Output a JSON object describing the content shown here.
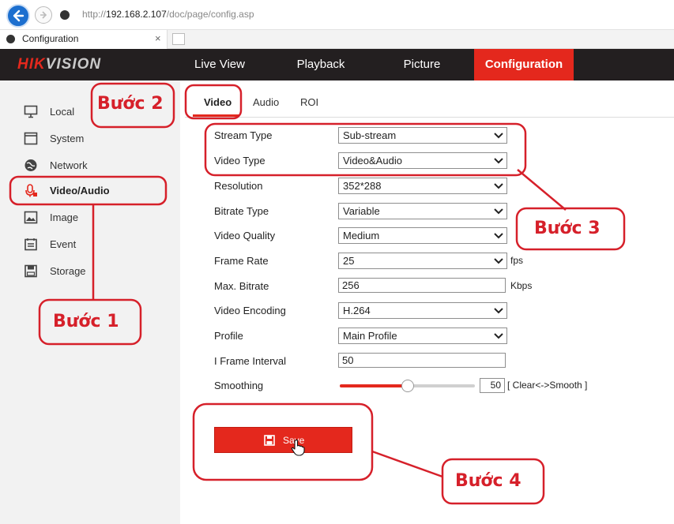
{
  "browser": {
    "url_prefix": "http://",
    "url_host": "192.168.2.107",
    "url_path": "/doc/page/config.asp",
    "tab_title": "Configuration",
    "tab_close": "×"
  },
  "header": {
    "logo_red": "HIK",
    "logo_grey": "VISION",
    "nav": [
      "Live View",
      "Playback",
      "Picture",
      "Configuration"
    ]
  },
  "sidebar": {
    "items": [
      {
        "label": "Local",
        "icon": "monitor-icon"
      },
      {
        "label": "System",
        "icon": "window-icon"
      },
      {
        "label": "Network",
        "icon": "globe-icon"
      },
      {
        "label": "Video/Audio",
        "icon": "microphone-icon"
      },
      {
        "label": "Image",
        "icon": "image-icon"
      },
      {
        "label": "Event",
        "icon": "calendar-icon"
      },
      {
        "label": "Storage",
        "icon": "disk-icon"
      }
    ],
    "active": "Video/Audio"
  },
  "tabs": [
    "Video",
    "Audio",
    "ROI"
  ],
  "form": {
    "stream_type": {
      "label": "Stream Type",
      "value": "Sub-stream"
    },
    "video_type": {
      "label": "Video Type",
      "value": "Video&Audio"
    },
    "resolution": {
      "label": "Resolution",
      "value": "352*288"
    },
    "bitrate_type": {
      "label": "Bitrate Type",
      "value": "Variable"
    },
    "video_quality": {
      "label": "Video Quality",
      "value": "Medium"
    },
    "frame_rate": {
      "label": "Frame Rate",
      "value": "25",
      "unit": "fps"
    },
    "max_bitrate": {
      "label": "Max. Bitrate",
      "value": "256",
      "unit": "Kbps"
    },
    "video_encoding": {
      "label": "Video Encoding",
      "value": "H.264"
    },
    "profile": {
      "label": "Profile",
      "value": "Main Profile"
    },
    "i_frame_interval": {
      "label": "I Frame Interval",
      "value": "50"
    },
    "smoothing": {
      "label": "Smoothing",
      "value": "50",
      "hint": "[ Clear<->Smooth ]",
      "level_percent": 50
    }
  },
  "save_label": "Save",
  "annotations": {
    "step1": "Bước 1",
    "step2": "Bước 2",
    "step3": "Bước 3",
    "step4": "Bước 4",
    "color": "#d6202a"
  },
  "colors": {
    "accent": "#e4281d",
    "header_bg": "#231f20",
    "sidebar_bg": "#f2f2f2"
  }
}
